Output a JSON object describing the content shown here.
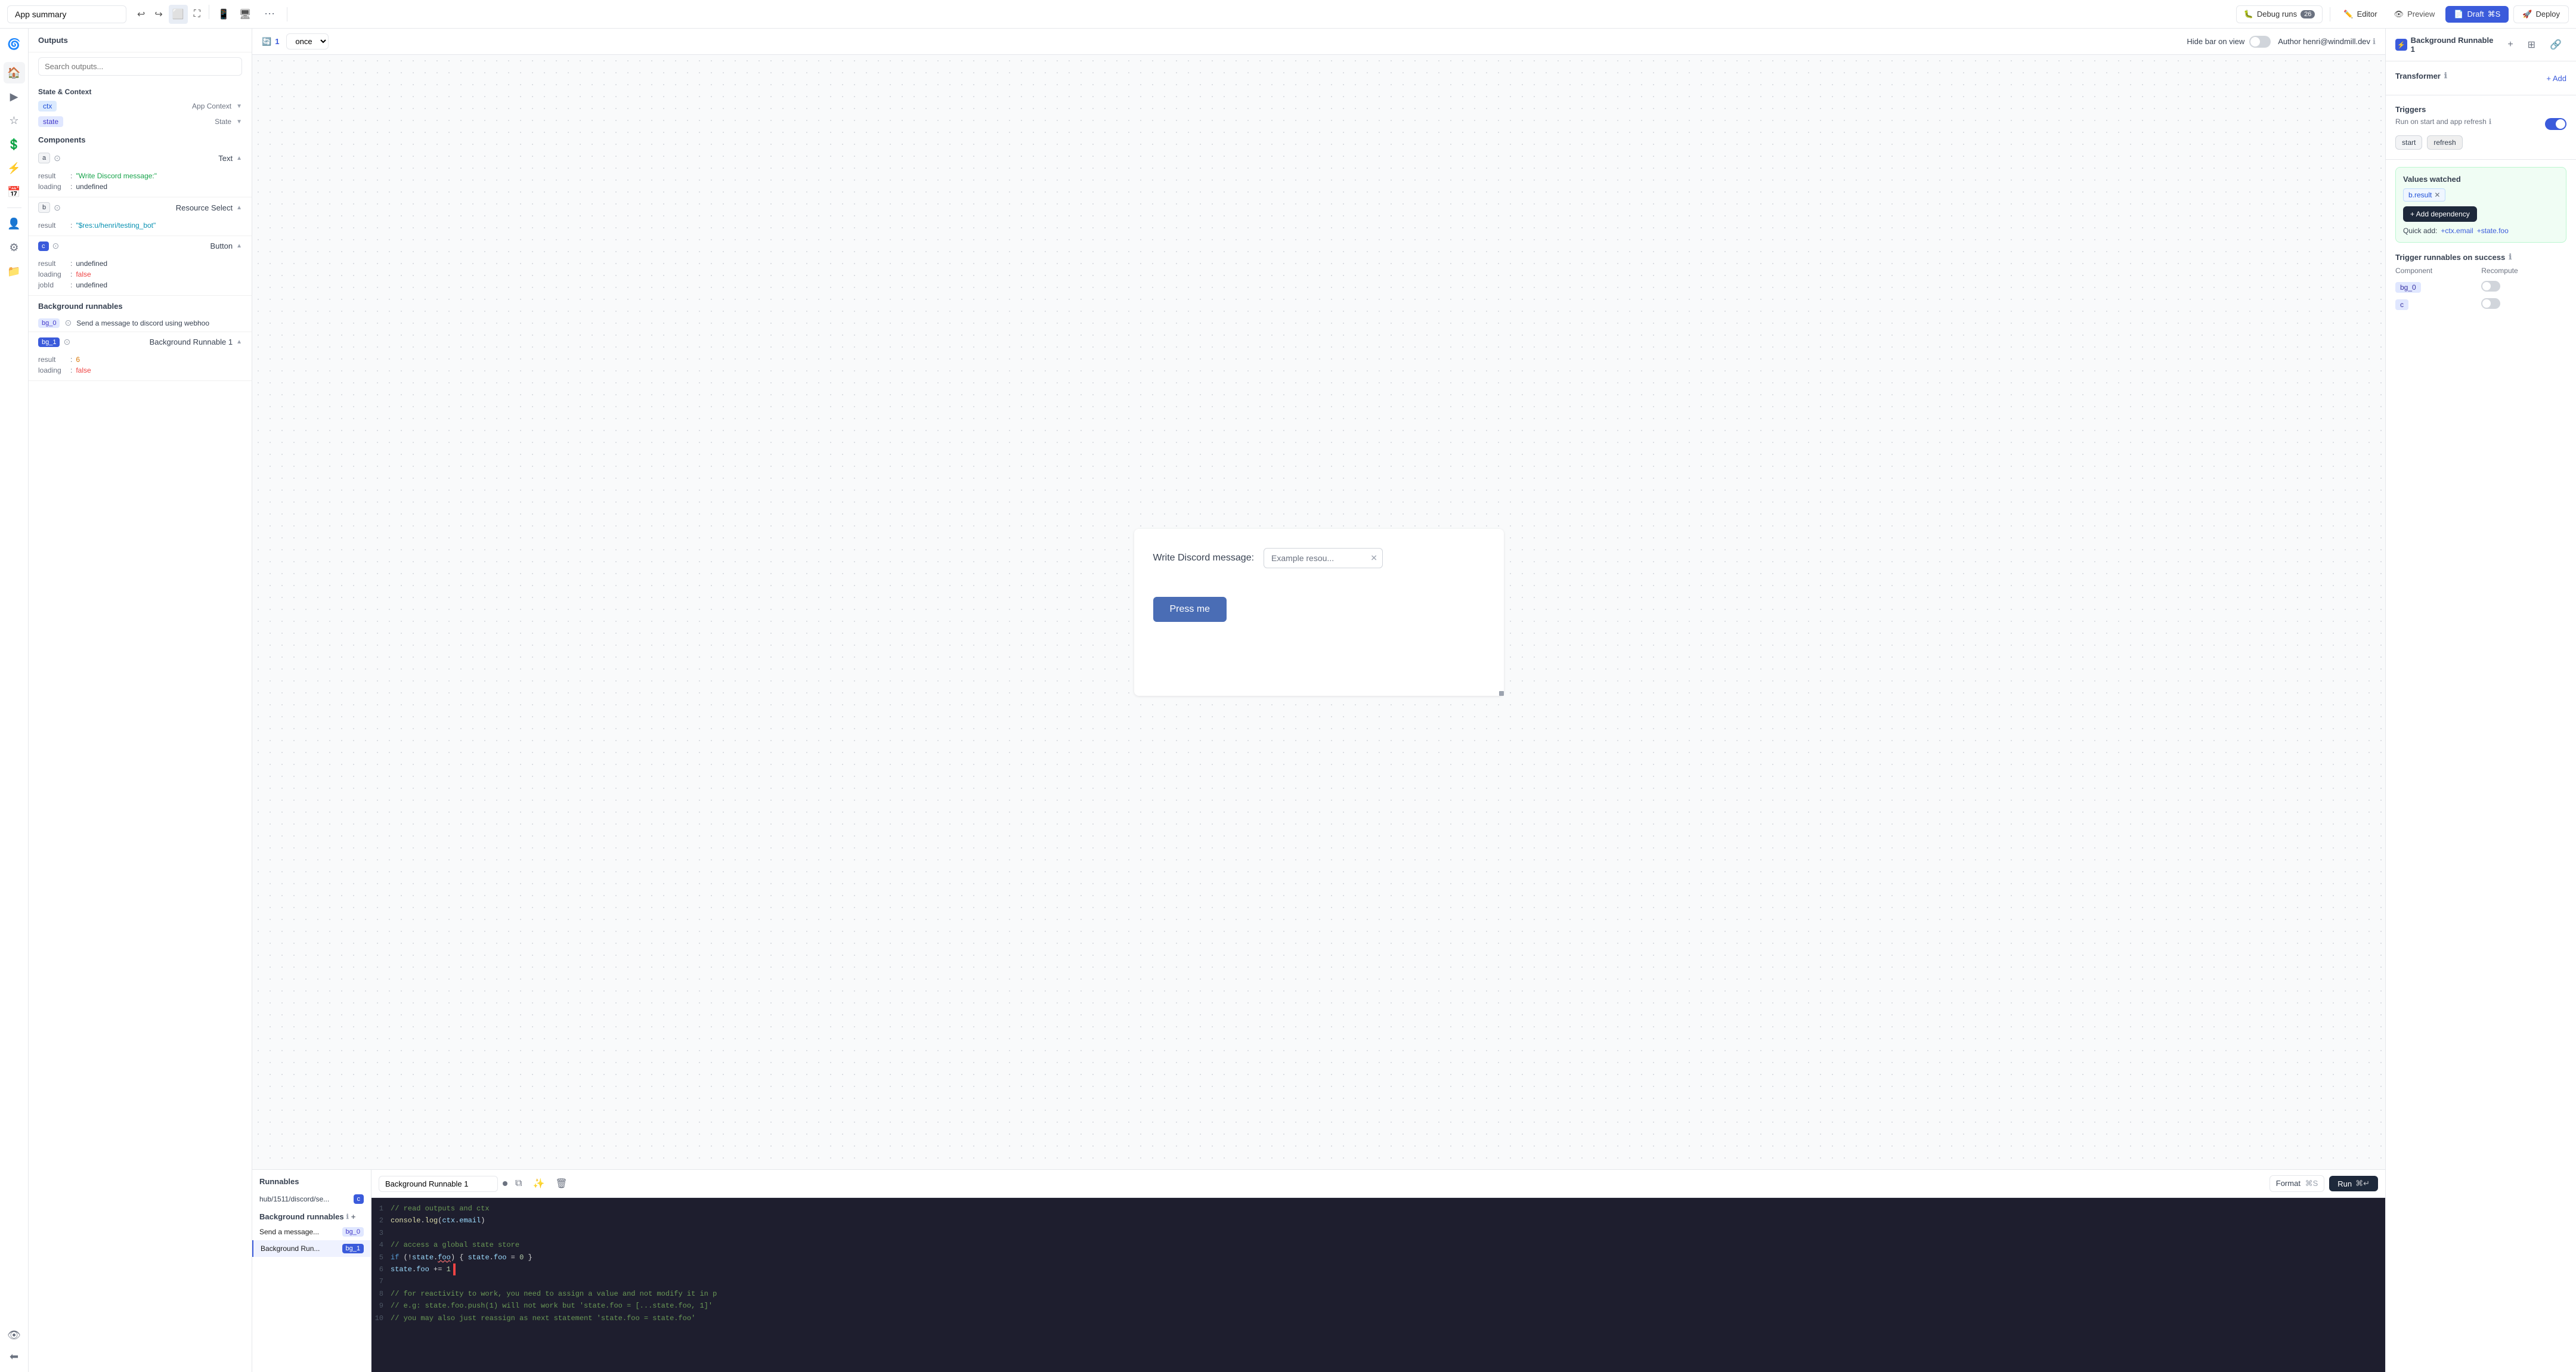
{
  "topbar": {
    "app_title": "App summary",
    "debug_label": "Debug runs",
    "debug_count": "26",
    "editor_label": "Editor",
    "preview_label": "Preview",
    "draft_label": "Draft",
    "draft_shortcut": "⌘S",
    "deploy_label": "Deploy"
  },
  "left_panel": {
    "outputs_title": "Outputs",
    "search_placeholder": "Search outputs...",
    "state_context_title": "State & Context",
    "ctx_label": "ctx",
    "ctx_value": "App Context",
    "state_label": "state",
    "state_value": "State",
    "components_title": "Components",
    "components": [
      {
        "id": "a",
        "type": "Text",
        "details": [
          {
            "key": "result",
            "val": "\"Write Discord message:\"",
            "type": "str"
          },
          {
            "key": "loading",
            "val": "undefined",
            "type": "plain"
          }
        ]
      },
      {
        "id": "b",
        "type": "Resource Select",
        "details": [
          {
            "key": "result",
            "val": "\"$res:u/henri/testing_bot\"",
            "type": "str2"
          }
        ]
      },
      {
        "id": "c",
        "type": "Button",
        "details": [
          {
            "key": "result",
            "val": "undefined",
            "type": "plain"
          },
          {
            "key": "loading",
            "val": "false",
            "type": "false"
          },
          {
            "key": "jobId",
            "val": "undefined",
            "type": "plain"
          }
        ]
      }
    ],
    "bg_runnables_title": "Background runnables",
    "bg_runnables": [
      {
        "id": "bg_0",
        "label": "Send a message to discord using webhoo",
        "details": []
      },
      {
        "id": "bg_1",
        "label": "Background Runnable 1",
        "details": [
          {
            "key": "result",
            "val": "6",
            "type": "num"
          },
          {
            "key": "loading",
            "val": "false",
            "type": "false"
          }
        ]
      }
    ]
  },
  "canvas": {
    "run_count": "1",
    "frequency": "once",
    "hide_bar_label": "Hide bar on view",
    "author_label": "Author henri@windmill.dev",
    "discord_label": "Write Discord message:",
    "discord_placeholder": "Example resou...",
    "press_button_label": "Press me",
    "zoom": "100%"
  },
  "runnables_panel": {
    "title": "Runnables",
    "items": [
      {
        "name": "hub/1511/discord/se...",
        "tag": "c"
      }
    ],
    "bg_title": "Background runnables",
    "bg_items": [
      {
        "name": "Send a message...",
        "tag": "bg_0"
      },
      {
        "name": "Background Run...",
        "tag": "bg_1"
      }
    ]
  },
  "code_editor": {
    "title": "Background Runnable 1",
    "format_label": "Format",
    "format_shortcut": "⌘S",
    "run_label": "Run",
    "run_shortcut": "⌘↵",
    "lines": [
      {
        "num": "1",
        "code": "// read outputs and ctx",
        "type": "comment"
      },
      {
        "num": "2",
        "code": "console.log(ctx.email)",
        "type": "mixed"
      },
      {
        "num": "3",
        "code": "",
        "type": "plain"
      },
      {
        "num": "4",
        "code": "// access a global state store",
        "type": "comment"
      },
      {
        "num": "5",
        "code": "if (!state.foo) { state.foo = 0 }",
        "type": "mixed"
      },
      {
        "num": "6",
        "code": "state.foo += 1",
        "type": "mixed"
      },
      {
        "num": "7",
        "code": "",
        "type": "plain"
      },
      {
        "num": "8",
        "code": "// for reactivity to work, you need to assign a value and not modify it in p",
        "type": "comment"
      },
      {
        "num": "9",
        "code": "// e.g: state.foo.push(1) will not work but 'state.foo = [...state.foo, 1]'",
        "type": "comment"
      },
      {
        "num": "10",
        "code": "// you may also just reassign as next statement 'state.foo = state.foo'",
        "type": "comment"
      }
    ]
  },
  "right_panel": {
    "bg_runnable_title": "Background Runnable 1",
    "transformer_title": "Transformer",
    "add_label": "+ Add",
    "triggers_title": "Triggers",
    "triggers_desc": "Run on start and app refresh",
    "events": [
      "start",
      "refresh"
    ],
    "values_watched_title": "Values watched",
    "watched_values": [
      "b.result"
    ],
    "add_dep_label": "+ Add dependency",
    "quick_add_label": "Quick add:",
    "quick_tags": [
      "+ctx.email",
      "+state.foo"
    ],
    "trigger_runnables_title": "Trigger runnables on success",
    "trigger_table": {
      "headers": [
        "Component",
        "Recompute"
      ],
      "rows": [
        {
          "component": "bg_0",
          "recompute": false
        },
        {
          "component": "c",
          "recompute": false
        }
      ]
    }
  }
}
